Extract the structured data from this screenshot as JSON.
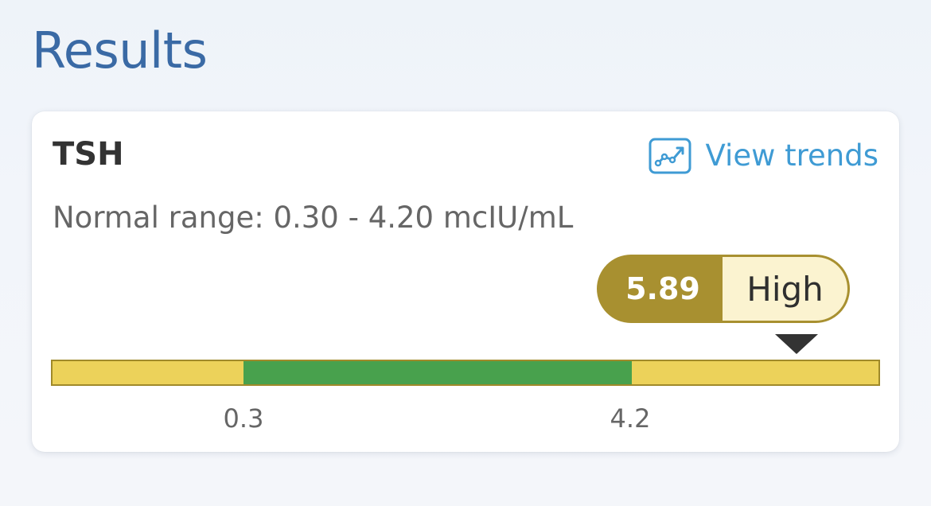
{
  "page": {
    "title": "Results"
  },
  "result_card": {
    "test_name": "TSH",
    "view_trends_label": "View trends",
    "trends_icon": "trend-chart-icon",
    "normal_range_text": "Normal range: 0.30 - 4.20 mcIU/mL",
    "value": "5.89",
    "flag": "High",
    "range_bar": {
      "low_threshold_label": "0.3",
      "high_threshold_label": "4.2",
      "colors": {
        "out_of_range": "#ecd25a",
        "normal": "#48a14d",
        "flag_pill": "#a89030",
        "flag_label_bg": "#fbf3d0"
      }
    }
  },
  "colors": {
    "title": "#3a6aa5",
    "link": "#3f9bd4"
  }
}
